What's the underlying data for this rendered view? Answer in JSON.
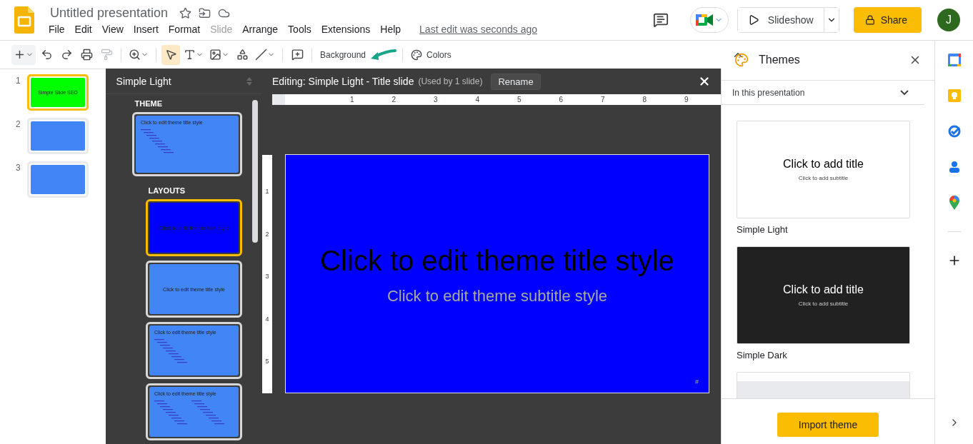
{
  "app": {
    "title": "Untitled presentation",
    "menu": [
      {
        "label": "File",
        "disabled": false
      },
      {
        "label": "Edit",
        "disabled": false
      },
      {
        "label": "View",
        "disabled": false
      },
      {
        "label": "Insert",
        "disabled": false
      },
      {
        "label": "Format",
        "disabled": false
      },
      {
        "label": "Slide",
        "disabled": true
      },
      {
        "label": "Arrange",
        "disabled": false
      },
      {
        "label": "Tools",
        "disabled": false
      },
      {
        "label": "Extensions",
        "disabled": false
      },
      {
        "label": "Help",
        "disabled": false
      }
    ],
    "last_edit": "Last edit was seconds ago",
    "slideshow": "Slideshow",
    "share": "Share",
    "avatar": "J"
  },
  "toolbar": {
    "tools": [
      {
        "kind": "add",
        "dropdown": true,
        "selected": false,
        "disabled": false
      },
      {
        "kind": "undo",
        "dropdown": false,
        "selected": false,
        "disabled": false
      },
      {
        "kind": "redo",
        "dropdown": false,
        "selected": false,
        "disabled": false
      },
      {
        "kind": "print",
        "dropdown": false,
        "selected": false,
        "disabled": false
      },
      {
        "kind": "paint",
        "dropdown": false,
        "selected": false,
        "disabled": true
      },
      {
        "kind": "zoom",
        "dropdown": true,
        "selected": false,
        "disabled": false
      },
      {
        "kind": "select",
        "dropdown": false,
        "selected": true,
        "disabled": false
      },
      {
        "kind": "textbox",
        "dropdown": true,
        "selected": false,
        "disabled": false
      },
      {
        "kind": "image",
        "dropdown": true,
        "selected": false,
        "disabled": false
      },
      {
        "kind": "shape",
        "dropdown": false,
        "selected": false,
        "disabled": false
      },
      {
        "kind": "line",
        "dropdown": true,
        "selected": false,
        "disabled": false
      },
      {
        "kind": "comment",
        "dropdown": false,
        "selected": false,
        "disabled": false
      }
    ],
    "background": "Background",
    "colors": "Colors"
  },
  "filmstrip": [
    {
      "number": "1",
      "color": "#00ff00",
      "selected": true,
      "text": "Simple Slide SEO"
    },
    {
      "number": "2",
      "color": "#4285f4",
      "selected": false
    },
    {
      "number": "3",
      "color": "#4285f4",
      "selected": false
    }
  ],
  "master_panel": {
    "title": "Simple Light",
    "theme_label": "THEME",
    "theme": {
      "kind": "title-body",
      "color": "#4285f4",
      "title": "Click to edit theme title style",
      "selected": false
    },
    "layouts_label": "LAYOUTS",
    "layouts": [
      {
        "kind": "title",
        "color": "#0000ff",
        "title": "Click to edit theme title style",
        "selected": true
      },
      {
        "kind": "section",
        "color": "#4285f4",
        "title": "Click to edit theme title style",
        "selected": false
      },
      {
        "kind": "title-body",
        "color": "#4285f4",
        "title": "Click to edit theme title style",
        "selected": false
      },
      {
        "kind": "two-column",
        "color": "#4285f4",
        "title": "Click to edit theme title style",
        "selected": false
      }
    ]
  },
  "editor": {
    "heading": "Editing: Simple Light - Title slide",
    "usage": "(Used by 1 slide)",
    "rename": "Rename",
    "ruler": [
      "1",
      "2",
      "3",
      "4",
      "5",
      "6",
      "7",
      "8",
      "9"
    ],
    "vruler": [
      "1",
      "2",
      "3",
      "4",
      "5"
    ],
    "slide": {
      "color": "#0000ff",
      "title": "Click to edit theme title style",
      "subtitle": "Click to edit theme subtitle style",
      "number": "#"
    }
  },
  "themes": {
    "title": "Themes",
    "filter": "In this presentation",
    "items": [
      {
        "kind": "light",
        "name": "Simple Light",
        "title": "Click to add title",
        "subtitle": "Click to add subtitle"
      },
      {
        "kind": "dark",
        "name": "Simple Dark",
        "title": "Click to add title",
        "subtitle": "Click to add subtitle"
      },
      {
        "kind": "partial"
      }
    ],
    "import": "Import theme"
  }
}
